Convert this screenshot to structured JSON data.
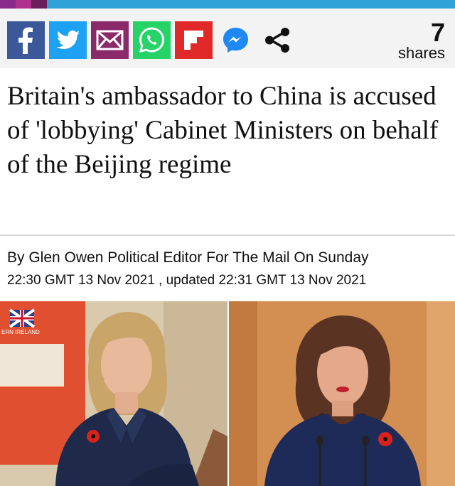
{
  "colors": {
    "facebook": "#3b5998",
    "twitter": "#1da1f2",
    "email": "#8a2a6a",
    "whatsapp": "#25d366",
    "flipboard": "#e12828",
    "messenger": "#1e88f5",
    "topbar": [
      "#8a2a8a",
      "#b03090",
      "#6a1f5a",
      "#2fa3d8"
    ]
  },
  "share": {
    "buttons": [
      {
        "icon": "facebook-icon"
      },
      {
        "icon": "twitter-icon"
      },
      {
        "icon": "email-icon"
      },
      {
        "icon": "whatsapp-icon"
      },
      {
        "icon": "flipboard-icon"
      },
      {
        "icon": "messenger-icon"
      },
      {
        "icon": "share-icon"
      }
    ],
    "count": "7",
    "count_label": "shares"
  },
  "article": {
    "headline": "Britain's ambassador to China is accused of 'lobbying' Cabinet Ministers on behalf of the Beijing regime",
    "byline": "By Glen Owen Political Editor For The Mail On Sunday",
    "published": "22:30 GMT 13 Nov 2021",
    "separator": " , updated ",
    "updated": "22:31 GMT 13 Nov 2021"
  },
  "photos": {
    "left_sign_text": "ERN IRELAND"
  }
}
